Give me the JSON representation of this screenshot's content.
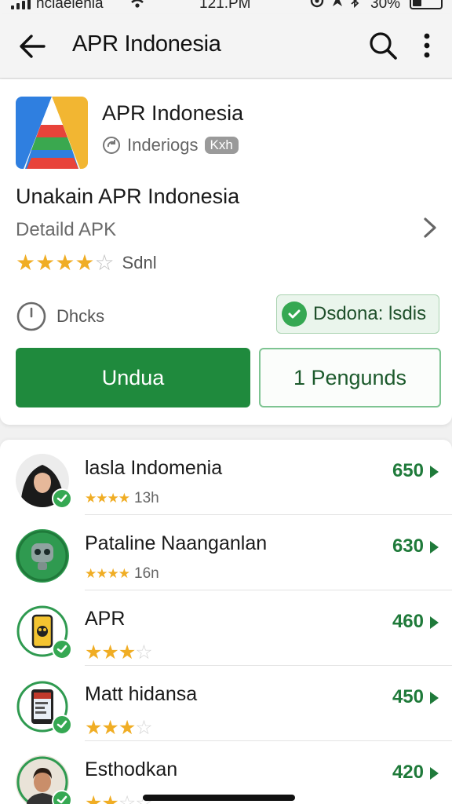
{
  "status_bar": {
    "carrier": "nciaeienia",
    "time": "121.PM",
    "battery_pct": "30%"
  },
  "app_bar": {
    "title": "APR Indonesia",
    "icons": [
      "back-arrow-icon",
      "search-icon",
      "more-vertical-icon"
    ]
  },
  "app_detail": {
    "name": "APR Indonesia",
    "developer": "Inderiogs",
    "badge": "Kxh",
    "headline": "Unakain APR Indonesia",
    "subheadline": "Detaild APK",
    "rating_stars": 4,
    "rating_text": "Sdnl",
    "downloads_label": "Dhcks",
    "verified_label": "Dsdona: lsdis",
    "primary_button": "Undua",
    "secondary_button": "1 Pengunds",
    "colors": {
      "primary": "#1f8a3d",
      "star": "#f0ad24",
      "verified": "#35a852"
    }
  },
  "list": [
    {
      "name": "lasla Indomenia",
      "stars": 4,
      "age": "13h",
      "count": "650",
      "avatar": "woman-hijab-avatar"
    },
    {
      "name": "Pataline Naanganlan",
      "stars": 4,
      "age": "16n",
      "count": "630",
      "avatar": "robot-avatar"
    },
    {
      "name": "APR",
      "stars": 3,
      "age": "",
      "count": "460",
      "avatar": "phone-avatar"
    },
    {
      "name": "Matt hidansa",
      "stars": 3,
      "age": "",
      "count": "450",
      "avatar": "phone-screen-avatar"
    },
    {
      "name": "Esthodkan",
      "stars": 2,
      "age": "",
      "count": "420",
      "avatar": "man-avatar"
    }
  ]
}
